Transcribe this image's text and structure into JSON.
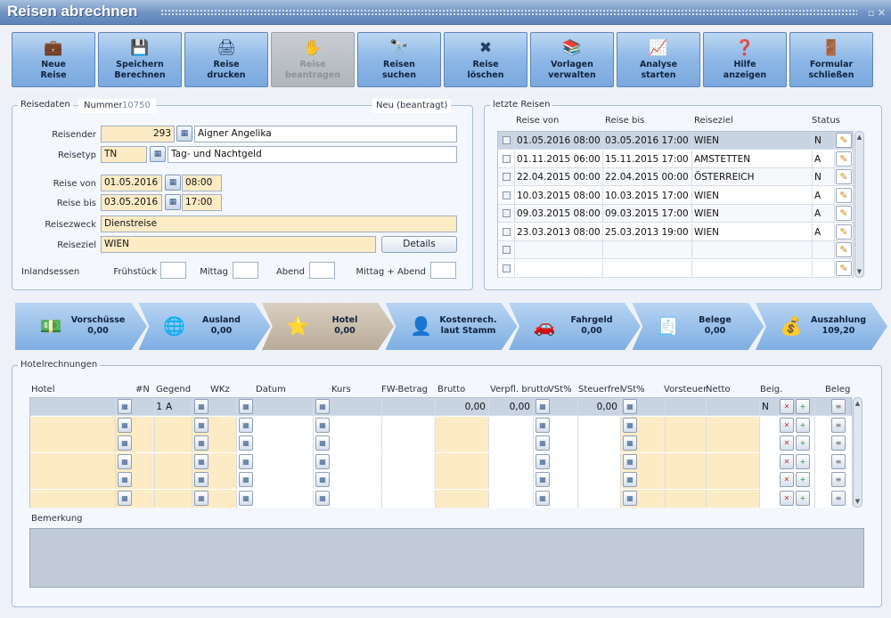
{
  "window": {
    "title": "Reisen abrechnen",
    "controls": "▫ ✕"
  },
  "toolbar": [
    {
      "id": "neue-reise",
      "line1": "Neue",
      "line2": "Reise",
      "icon": "briefcase-new-icon",
      "glyph": "💼",
      "enabled": true
    },
    {
      "id": "speichern-berechnen",
      "line1": "Speichern",
      "line2": "Berechnen",
      "icon": "save-icon",
      "glyph": "💾",
      "enabled": true
    },
    {
      "id": "reise-drucken",
      "line1": "Reise",
      "line2": "drucken",
      "icon": "printer-icon",
      "glyph": "🖨",
      "enabled": true
    },
    {
      "id": "reise-beantragen",
      "line1": "Reise",
      "line2": "beantragen",
      "icon": "hand-icon",
      "glyph": "✋",
      "enabled": false
    },
    {
      "id": "reisen-suchen",
      "line1": "Reisen",
      "line2": "suchen",
      "icon": "binoculars-icon",
      "glyph": "🔭",
      "enabled": true
    },
    {
      "id": "reise-loeschen",
      "line1": "Reise",
      "line2": "löschen",
      "icon": "briefcase-delete-icon",
      "glyph": "✖",
      "enabled": true
    },
    {
      "id": "vorlagen-verwalten",
      "line1": "Vorlagen",
      "line2": "verwalten",
      "icon": "templates-icon",
      "glyph": "📚",
      "enabled": true
    },
    {
      "id": "analyse-starten",
      "line1": "Analyse",
      "line2": "starten",
      "icon": "chart-icon",
      "glyph": "📈",
      "enabled": true
    },
    {
      "id": "hilfe-anzeigen",
      "line1": "Hilfe",
      "line2": "anzeigen",
      "icon": "help-icon",
      "glyph": "❓",
      "enabled": true
    },
    {
      "id": "formular-schliessen",
      "line1": "Formular",
      "line2": "schließen",
      "icon": "exit-door-icon",
      "glyph": "🚪",
      "enabled": true
    }
  ],
  "reisedaten": {
    "legend": "Reisedaten",
    "nummer_label": "Nummer",
    "nummer_value": "10750",
    "status_text": "Neu (beantragt)",
    "reisender_label": "Reisender",
    "reisender_id": "293",
    "reisender_name": "Aigner Angelika",
    "reisetyp_label": "Reisetyp",
    "reisetyp_code": "TN",
    "reisetyp_name": "Tag- und Nachtgeld",
    "reise_von_label": "Reise von",
    "reise_von_date": "01.05.2016",
    "reise_von_time": "08:00",
    "reise_bis_label": "Reise bis",
    "reise_bis_date": "03.05.2016",
    "reise_bis_time": "17:00",
    "reisezweck_label": "Reisezweck",
    "reisezweck_value": "Dienstreise",
    "reiseziel_label": "Reiseziel",
    "reiseziel_value": "WIEN",
    "details_button": "Details",
    "inlandsessen_label": "Inlandsessen",
    "fruehstueck_label": "Frühstück",
    "mittag_label": "Mittag",
    "abend_label": "Abend",
    "mittag_abend_label": "Mittag + Abend"
  },
  "letzte_reisen": {
    "legend": "letzte Reisen",
    "headers": {
      "von": "Reise von",
      "bis": "Reise bis",
      "ziel": "Reiseziel",
      "status": "Status"
    },
    "rows": [
      {
        "von": "01.05.2016 08:00",
        "bis": "03.05.2016 17:00",
        "ziel": "WIEN",
        "status": "N",
        "selected": true
      },
      {
        "von": "01.11.2015 06:00",
        "bis": "15.11.2015 17:00",
        "ziel": "AMSTETTEN",
        "status": "A"
      },
      {
        "von": "22.04.2015 00:00",
        "bis": "22.04.2015 00:00",
        "ziel": "ÖSTERREICH",
        "status": "N"
      },
      {
        "von": "10.03.2015 08:00",
        "bis": "10.03.2015 17:00",
        "ziel": "WIEN",
        "status": "A"
      },
      {
        "von": "09.03.2015 08:00",
        "bis": "09.03.2015 17:00",
        "ziel": "WIEN",
        "status": "A"
      },
      {
        "von": "23.03.2013 08:00",
        "bis": "25.03.2013 19:00",
        "ziel": "WIEN",
        "status": "A"
      },
      {
        "von": "",
        "bis": "",
        "ziel": "",
        "status": ""
      },
      {
        "von": "",
        "bis": "",
        "ziel": "",
        "status": ""
      }
    ]
  },
  "steps": [
    {
      "id": "vorschuesse",
      "line1": "Vorschüsse",
      "line2": "0,00",
      "icon": "money-icon",
      "glyph": "💵"
    },
    {
      "id": "ausland",
      "line1": "Ausland",
      "line2": "0,00",
      "icon": "globe-icon",
      "glyph": "🌐"
    },
    {
      "id": "hotel",
      "line1": "Hotel",
      "line2": "0,00",
      "icon": "coins-star-icon",
      "glyph": "⭐",
      "active": true
    },
    {
      "id": "kostenrech",
      "line1": "Kostenrech.",
      "line2": "laut Stamm",
      "icon": "person-icon",
      "glyph": "👤"
    },
    {
      "id": "fahrgeld",
      "line1": "Fahrgeld",
      "line2": "0,00",
      "icon": "car-icon",
      "glyph": "🚗"
    },
    {
      "id": "belege",
      "line1": "Belege",
      "line2": "0,00",
      "icon": "receipt-icon",
      "glyph": "🧾"
    },
    {
      "id": "auszahlung",
      "line1": "Auszahlung",
      "line2": "109,20",
      "icon": "cash-register-icon",
      "glyph": "💰"
    }
  ],
  "hotel": {
    "legend": "Hotelrechnungen",
    "headers": {
      "hotel": "Hotel",
      "n": "#N",
      "gegend": "Gegend",
      "wkz": "WKz",
      "datum": "Datum",
      "kurs": "Kurs",
      "fw": "FW-Betrag",
      "brutto": "Brutto",
      "verpfl": "Verpfl. brutto",
      "vst1": "VSt%",
      "steuerfrei": "Steuerfrei",
      "vst2": "VSt%",
      "vorsteuer": "Vorsteuer",
      "netto": "Netto",
      "beig": "Beig.",
      "beleg": "Beleg"
    },
    "rows": [
      {
        "n": "1",
        "gegend": "A",
        "brutto": "0,00",
        "verpfl": "0,00",
        "steuerfrei": "0,00",
        "beig": "N",
        "selected": true
      },
      {
        "n": "",
        "gegend": "",
        "brutto": "",
        "verpfl": "",
        "steuerfrei": "",
        "beig": ""
      },
      {
        "n": "",
        "gegend": "",
        "brutto": "",
        "verpfl": "",
        "steuerfrei": "",
        "beig": ""
      },
      {
        "n": "",
        "gegend": "",
        "brutto": "",
        "verpfl": "",
        "steuerfrei": "",
        "beig": ""
      },
      {
        "n": "",
        "gegend": "",
        "brutto": "",
        "verpfl": "",
        "steuerfrei": "",
        "beig": ""
      },
      {
        "n": "",
        "gegend": "",
        "brutto": "",
        "verpfl": "",
        "steuerfrei": "",
        "beig": ""
      }
    ],
    "bemerkung_label": "Bemerkung"
  },
  "colors": {
    "accent": "#7eaee2",
    "input_yellow": "#fdebc6",
    "title_bar": "#6f92c2"
  }
}
